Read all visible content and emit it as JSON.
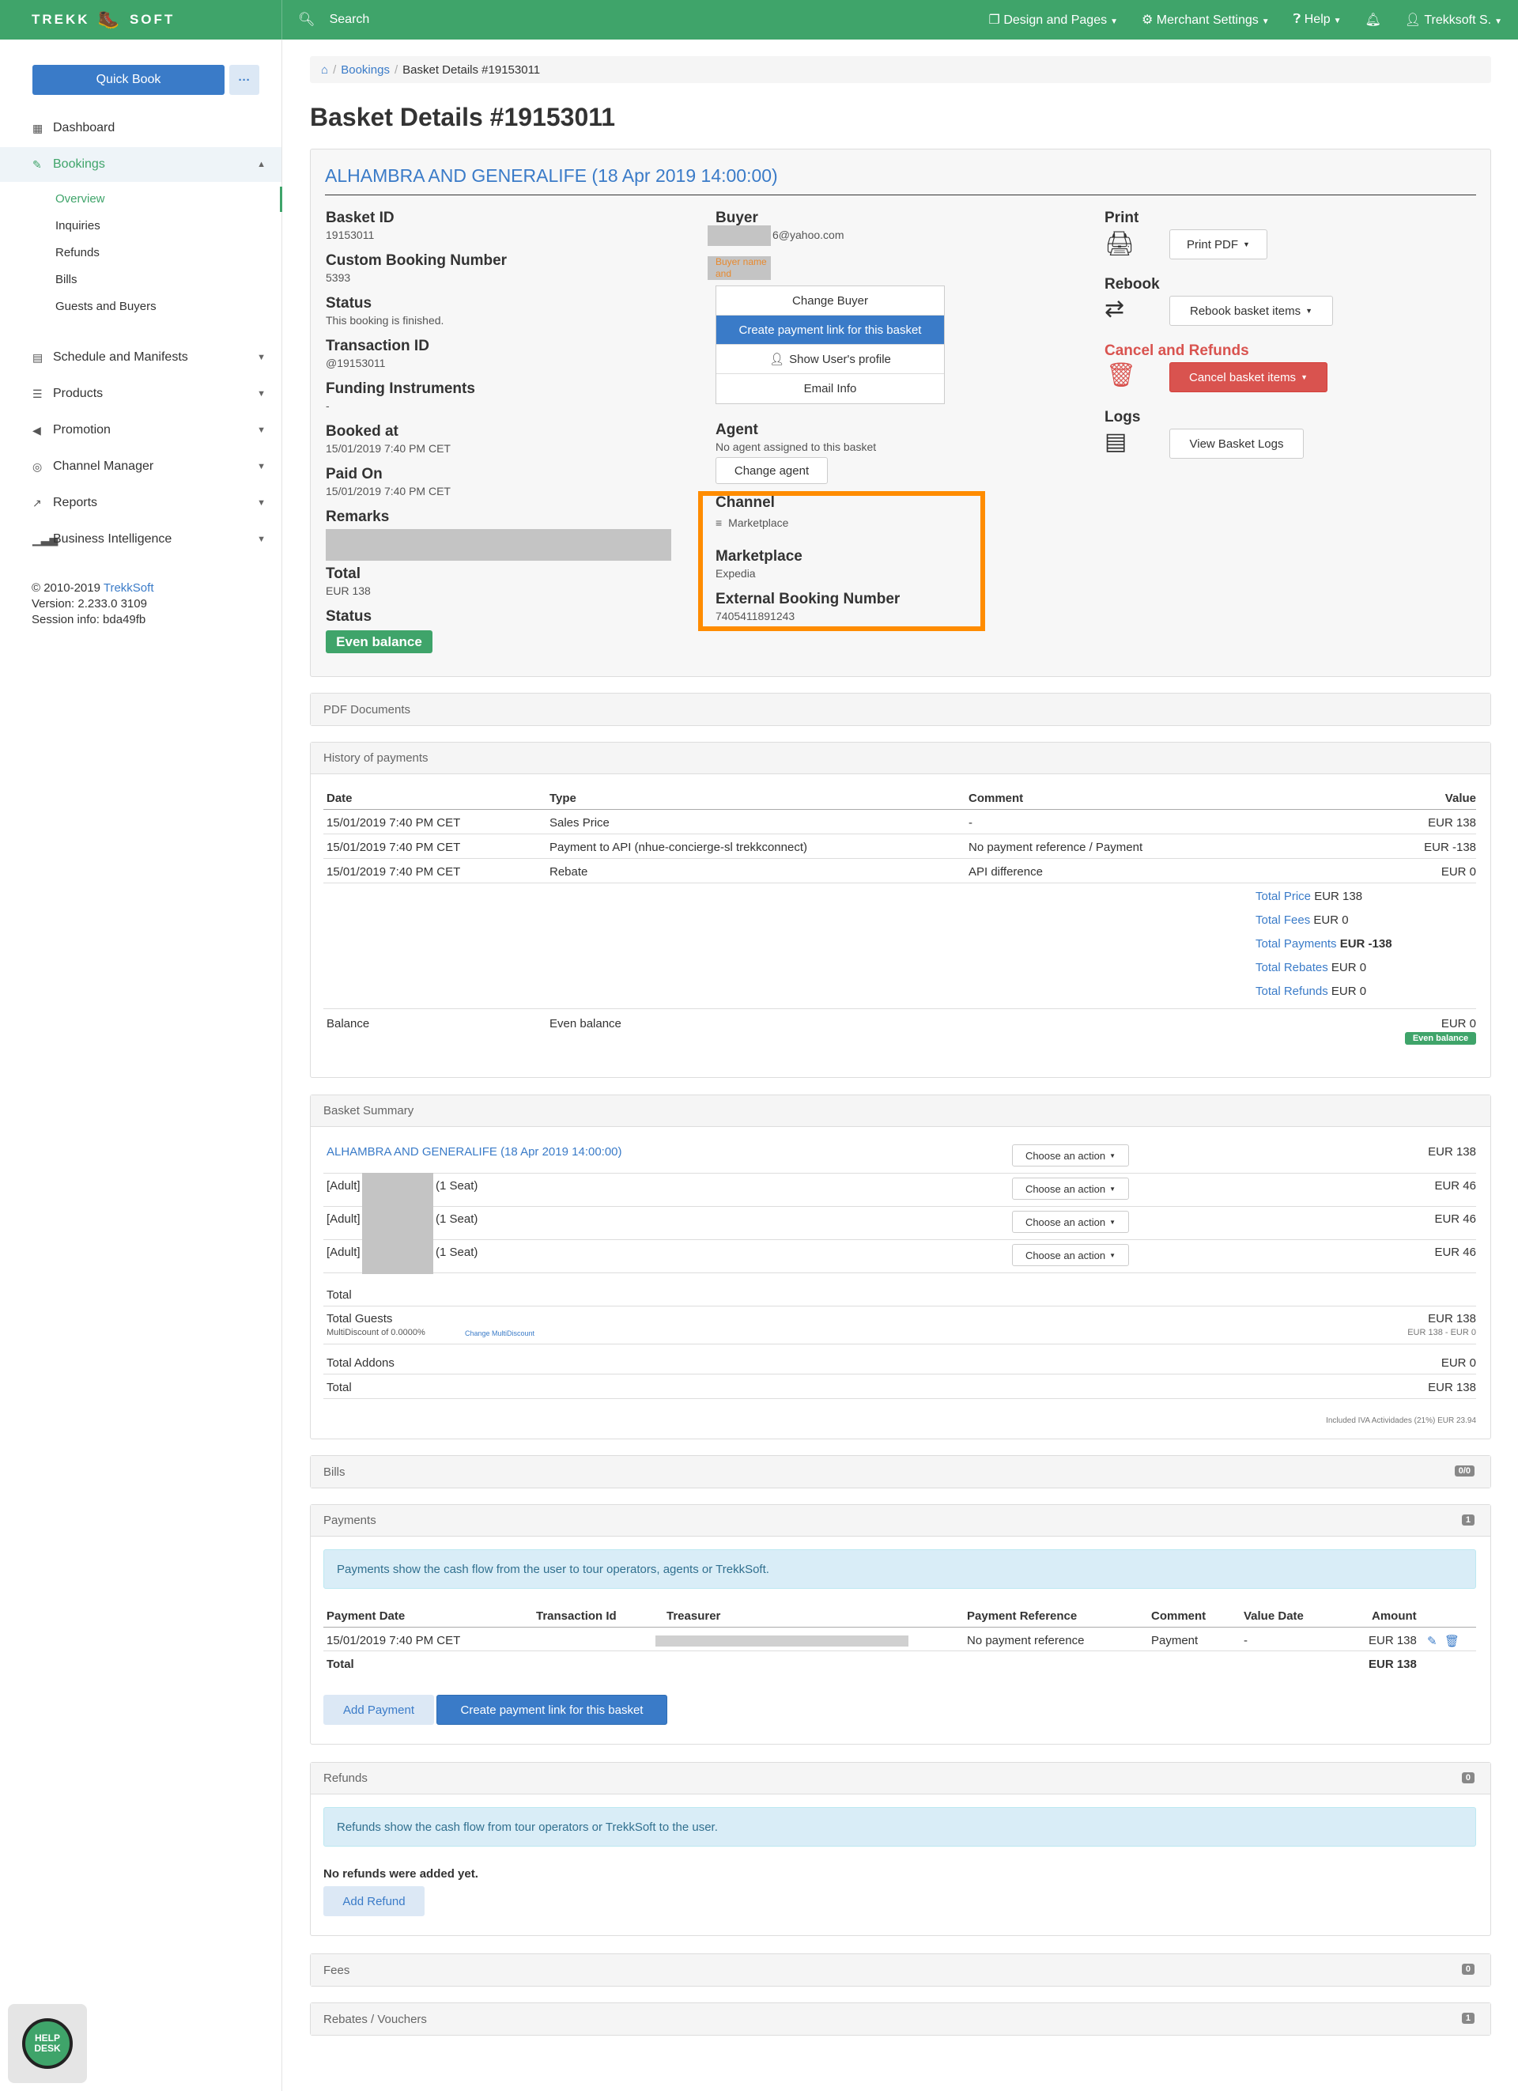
{
  "topbar": {
    "logo_left": "TREKK",
    "logo_right": "SOFT",
    "search": "Search",
    "design": "Design and Pages",
    "merchant": "Merchant Settings",
    "help": "Help",
    "user": "Trekksoft S."
  },
  "sidebar": {
    "quick_book": "Quick Book",
    "more": "···",
    "items": [
      {
        "label": "Dashboard",
        "icon": "dashboard-icon"
      },
      {
        "label": "Bookings",
        "icon": "tag-icon"
      },
      {
        "label": "Schedule and Manifests",
        "icon": "calendar-icon"
      },
      {
        "label": "Products",
        "icon": "list-icon"
      },
      {
        "label": "Promotion",
        "icon": "megaphone-icon"
      },
      {
        "label": "Channel Manager",
        "icon": "globe-icon"
      },
      {
        "label": "Reports",
        "icon": "line-chart-icon"
      },
      {
        "label": "Business Intelligence",
        "icon": "bar-chart-icon"
      }
    ],
    "sub": [
      "Overview",
      "Inquiries",
      "Refunds",
      "Bills",
      "Guests and Buyers"
    ],
    "footer_copy": "© 2010-2019",
    "footer_brand": "TrekkSoft",
    "version": "Version: 2.233.0 3109",
    "session": "Session info: bda49fb",
    "helpdesk": "HELP DESK"
  },
  "breadcrumb": {
    "home": "home-icon",
    "bookings": "Bookings",
    "current": "Basket Details #19153011"
  },
  "page_title": "Basket Details #19153011",
  "basket": {
    "heading": "ALHAMBRA AND GENERALIFE (18 Apr 2019 14:00:00)",
    "basket_id_label": "Basket ID",
    "basket_id": "19153011",
    "custom_label": "Custom Booking Number",
    "custom": "5393",
    "status_label": "Status",
    "status": "This booking is finished.",
    "transaction_label": "Transaction ID",
    "transaction": "@19153011",
    "funding_label": "Funding Instruments",
    "funding": "-",
    "booked_label": "Booked at",
    "booked": "15/01/2019 7:40 PM CET",
    "paid_label": "Paid On",
    "paid": "15/01/2019 7:40 PM CET",
    "remarks_label": "Remarks",
    "total_label": "Total",
    "total": "EUR 138",
    "status2_label": "Status",
    "status2": "Even balance",
    "buyer_label": "Buyer",
    "buyer_email": "6@yahoo.com",
    "buyer_name_tag": "Buyer name and surname",
    "buyer_menu": [
      "Change Buyer",
      "Create payment link for this basket",
      "Show User's profile",
      "Email Info"
    ],
    "agent_label": "Agent",
    "agent": "No agent assigned to this basket",
    "change_agent": "Change agent",
    "channel_label": "Channel",
    "channel": "Marketplace",
    "marketplace_label": "Marketplace",
    "marketplace": "Expedia",
    "external_label": "External Booking Number",
    "external": "7405411891243",
    "print_label": "Print",
    "print_btn": "Print PDF",
    "rebook_label": "Rebook",
    "rebook_btn": "Rebook basket items",
    "cancel_label": "Cancel and Refunds",
    "cancel_btn": "Cancel basket items",
    "logs_label": "Logs",
    "logs_btn": "View Basket Logs",
    "cancel_color": "#d9534f"
  },
  "pdf": {
    "title": "PDF Documents"
  },
  "history": {
    "title": "History of payments",
    "headers": [
      "Date",
      "Type",
      "Comment",
      "Value"
    ],
    "rows": [
      {
        "date": "15/01/2019 7:40 PM CET",
        "type": "Sales Price",
        "comment": "-",
        "value": "EUR 138"
      },
      {
        "date": "15/01/2019 7:40 PM CET",
        "type": "Payment to API (nhue-concierge-sl trekkconnect)",
        "comment": "No payment reference / Payment",
        "value": "EUR -138"
      },
      {
        "date": "15/01/2019 7:40 PM CET",
        "type": "Rebate",
        "comment": "API difference",
        "value": "EUR 0"
      }
    ],
    "totals": [
      {
        "label": "Total Price",
        "value": "EUR 138"
      },
      {
        "label": "Total Fees",
        "value": "EUR 0"
      },
      {
        "label": "Total Payments",
        "value": "EUR -138"
      },
      {
        "label": "Total Rebates",
        "value": "EUR 0"
      },
      {
        "label": "Total Refunds",
        "value": "EUR 0"
      }
    ],
    "balance_label": "Balance",
    "balance_text": "Even balance",
    "balance_value": "EUR 0",
    "balance_badge": "Even balance"
  },
  "summary": {
    "title": "Basket Summary",
    "product": "ALHAMBRA AND GENERALIFE (18 Apr 2019 14:00:00)",
    "product_value": "EUR 138",
    "action": "Choose an action",
    "guests": [
      {
        "prefix": "[Adult]",
        "seat": "(1 Seat)",
        "value": "EUR 46"
      },
      {
        "prefix": "[Adult]",
        "seat": "(1 Seat)",
        "value": "EUR 46"
      },
      {
        "prefix": "[Adult]",
        "seat": "(1 Seat)",
        "value": "EUR 46"
      }
    ],
    "total1": "Total",
    "total_guests": "Total Guests",
    "total_guests_value": "EUR 138",
    "multidiscount": "MultiDiscount of 0.0000%",
    "change_md": "Change MultiDiscount",
    "md_value": "EUR 138 - EUR 0",
    "total_addons": "Total Addons",
    "total_addons_value": "EUR 0",
    "total2": "Total",
    "total2_value": "EUR 138",
    "vat": "Included IVA Actividades (21%) EUR 23.94"
  },
  "bills": {
    "title": "Bills",
    "badge": "0/0"
  },
  "payments": {
    "title": "Payments",
    "badge": "1",
    "info": "Payments show the cash flow from the user to tour operators, agents or TrekkSoft.",
    "headers": [
      "Payment Date",
      "Transaction Id",
      "Treasurer",
      "Payment Reference",
      "Comment",
      "Value Date",
      "Amount"
    ],
    "row": {
      "date": "15/01/2019 7:40 PM CET",
      "ref": "No payment reference",
      "comment": "Payment",
      "value_date": "-",
      "amount": "EUR 138"
    },
    "total_label": "Total",
    "total": "EUR 138",
    "add": "Add Payment",
    "create": "Create payment link for this basket"
  },
  "refunds": {
    "title": "Refunds",
    "badge": "0",
    "info": "Refunds show the cash flow from tour operators or TrekkSoft to the user.",
    "none": "No refunds were added yet.",
    "add": "Add Refund"
  },
  "fees": {
    "title": "Fees",
    "badge": "0"
  },
  "rebates": {
    "title": "Rebates / Vouchers",
    "badge": "1"
  }
}
